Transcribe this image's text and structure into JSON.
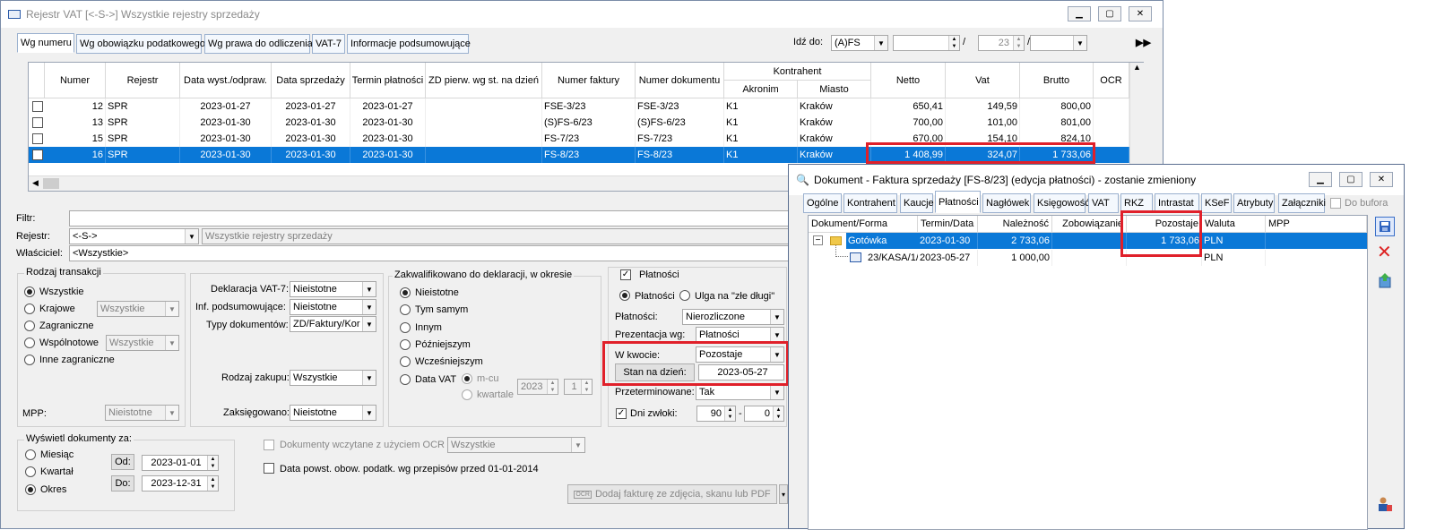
{
  "main_window": {
    "title": "Rejestr VAT  [<-S->]  Wszystkie rejestry sprzedaży",
    "tabs": [
      "Wg numeru",
      "Wg obowiązku podatkowego",
      "Wg prawa do odliczenia",
      "VAT-7",
      "Informacje podsumowujące"
    ],
    "goto_label": "Idź do:",
    "goto_value": "(A)FS",
    "goto_num": "23",
    "slash": "/",
    "table": {
      "headers": [
        "Numer",
        "Rejestr",
        "Data wyst./odpraw.",
        "Data sprzedaży",
        "Termin płatności",
        "ZD pierw. wg st. na dzień",
        "Numer faktury",
        "Numer dokumentu",
        "Kontrahent",
        "Akronim",
        "Miasto",
        "Netto",
        "Vat",
        "Brutto",
        "OCR"
      ],
      "rows": [
        {
          "numer": "12",
          "rejestr": "SPR",
          "data_wyst": "2023-01-27",
          "data_sprz": "2023-01-27",
          "termin": "2023-01-27",
          "zd": "",
          "faktura": "FSE-3/23",
          "dokument": "FSE-3/23",
          "akronim": "K1",
          "miasto": "Kraków",
          "netto": "650,41",
          "vat": "149,59",
          "brutto": "800,00"
        },
        {
          "numer": "13",
          "rejestr": "SPR",
          "data_wyst": "2023-01-30",
          "data_sprz": "2023-01-30",
          "termin": "2023-01-30",
          "zd": "",
          "faktura": "(S)FS-6/23",
          "dokument": "(S)FS-6/23",
          "akronim": "K1",
          "miasto": "Kraków",
          "netto": "700,00",
          "vat": "101,00",
          "brutto": "801,00"
        },
        {
          "numer": "15",
          "rejestr": "SPR",
          "data_wyst": "2023-01-30",
          "data_sprz": "2023-01-30",
          "termin": "2023-01-30",
          "zd": "",
          "faktura": "FS-7/23",
          "dokument": "FS-7/23",
          "akronim": "K1",
          "miasto": "Kraków",
          "netto": "670,00",
          "vat": "154,10",
          "brutto": "824,10"
        },
        {
          "numer": "16",
          "rejestr": "SPR",
          "data_wyst": "2023-01-30",
          "data_sprz": "2023-01-30",
          "termin": "2023-01-30",
          "zd": "",
          "faktura": "FS-8/23",
          "dokument": "FS-8/23",
          "akronim": "K1",
          "miasto": "Kraków",
          "netto": "1 408,99",
          "vat": "324,07",
          "brutto": "1 733,06"
        }
      ]
    },
    "filters": {
      "filtr_label": "Filtr:",
      "rejestr_label": "Rejestr:",
      "rejestr_value": "<-S->",
      "rejestr_desc": "Wszystkie rejestry sprzedaży",
      "wlasciciel_label": "Właściciel:",
      "wlasciciel_value": "<Wszystkie>"
    },
    "rodzaj": {
      "title": "Rodzaj transakcji",
      "options": [
        "Wszystkie",
        "Krajowe",
        "Zagraniczne",
        "Wspólnotowe",
        "Inne zagraniczne"
      ],
      "krajowe_combo": "Wszystkie",
      "wspolnotowe_combo": "Wszystkie",
      "mpp_label": "MPP:",
      "mpp_value": "Nieistotne"
    },
    "deklaracje": {
      "vat7_label": "Deklaracja VAT-7:",
      "vat7_value": "Nieistotne",
      "inf_label": "Inf. podsumowujące:",
      "inf_value": "Nieistotne",
      "typy_label": "Typy dokumentów:",
      "typy_value": "ZD/Faktury/Kor",
      "zakup_label": "Rodzaj zakupu:",
      "zakup_value": "Wszystkie",
      "zaksieg_label": "Zaksięgowano:",
      "zaksieg_value": "Nieistotne"
    },
    "zakwalif": {
      "title": "Zakwalifikowano do deklaracji, w okresie",
      "options": [
        "Nieistotne",
        "Tym samym",
        "Innym",
        "Późniejszym",
        "Wcześniejszym",
        "Data VAT"
      ],
      "mcu": "m-cu",
      "kwartale": "kwartale",
      "year": "2023",
      "month": "1"
    },
    "platnosci": {
      "title": "Płatności",
      "radio1": "Płatności",
      "radio2": "Ulga na \"złe długi\"",
      "platnosci_label": "Płatności:",
      "platnosci_value": "Nierozliczone",
      "prezentacja_label": "Prezentacja wg:",
      "prezentacja_value": "Płatności",
      "kwocie_label": "W kwocie:",
      "kwocie_value": "Pozostaje",
      "stan_button": "Stan na dzień:",
      "stan_value": "2023-05-27",
      "przeterm_label": "Przeterminowane:",
      "przeterm_value": "Tak",
      "dni_label": "Dni zwłoki:",
      "dni_from": "90",
      "dni_to": "0",
      "dash": "-"
    },
    "okres": {
      "title": "Wyświetl dokumenty za:",
      "options": [
        "Miesiąc",
        "Kwartał",
        "Okres"
      ],
      "od_label": "Od:",
      "od_value": "2023-01-01",
      "do_label": "Do:",
      "do_value": "2023-12-31"
    },
    "ocr_label": "Dokumenty wczytane z użyciem OCR",
    "ocr_value": "Wszystkie",
    "data_powst_label": "Data powst. obow. podatk. wg przepisów przed 01-01-2014",
    "dodaj_button": "Dodaj fakturę ze zdjęcia, skanu lub PDF",
    "ocr_icon_text": "OCR"
  },
  "doc_window": {
    "title": "Dokument - Faktura sprzedaży [FS-8/23] (edycja płatności) - zostanie zmieniony",
    "tabs": [
      "Ogólne",
      "Kontrahent",
      "Kaucje",
      "Płatności",
      "Nagłówek",
      "Księgowość",
      "VAT",
      "RKZ",
      "Intrastat",
      "KSeF",
      "Atrybuty",
      "Załączniki"
    ],
    "do_bufora": "Do bufora",
    "headers": [
      "Dokument/Forma",
      "Termin/Data",
      "Należność",
      "Zobowiązanie",
      "Pozostaje",
      "Waluta",
      "MPP"
    ],
    "rows": [
      {
        "name": "Gotówka",
        "date": "2023-01-30",
        "naleznosc": "2 733,06",
        "zobow": "",
        "pozostaje": "1 733,06",
        "waluta": "PLN"
      },
      {
        "name": "23/KASA/1/",
        "date": "2023-05-27",
        "naleznosc": "1 000,00",
        "zobow": "",
        "pozostaje": "",
        "waluta": "PLN"
      }
    ],
    "tree_minus": "−"
  },
  "colors": {
    "selection": "#0a78d7",
    "highlight": "#e0202a",
    "tab_border": "#9bb1cf"
  }
}
